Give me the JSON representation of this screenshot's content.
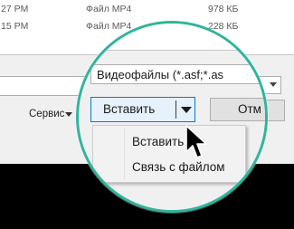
{
  "file_list": {
    "rows": [
      {
        "time": "27 PM",
        "type": "Файл MP4",
        "size": "978 КБ"
      },
      {
        "time": "15 PM",
        "type": "Файл MP4",
        "size": "228 КБ"
      }
    ]
  },
  "footer": {
    "tools_label": "Сервис",
    "file_type_filter": "Видеофайлы (*.asf;*.as",
    "insert_button": "Вставить",
    "cancel_button": "Отм"
  },
  "insert_menu": {
    "items": [
      {
        "label": "Вставить"
      },
      {
        "label": "Связь с файлом"
      }
    ]
  },
  "colors": {
    "magnifier_border": "#2fb59b",
    "button_focus": "#0078d7",
    "button_focus_bg": "#e5f1fb",
    "dialog_bg": "#f0f0f0"
  },
  "icons": {
    "dropdown": "chevron-down-icon",
    "pointer": "mouse-cursor-icon"
  }
}
